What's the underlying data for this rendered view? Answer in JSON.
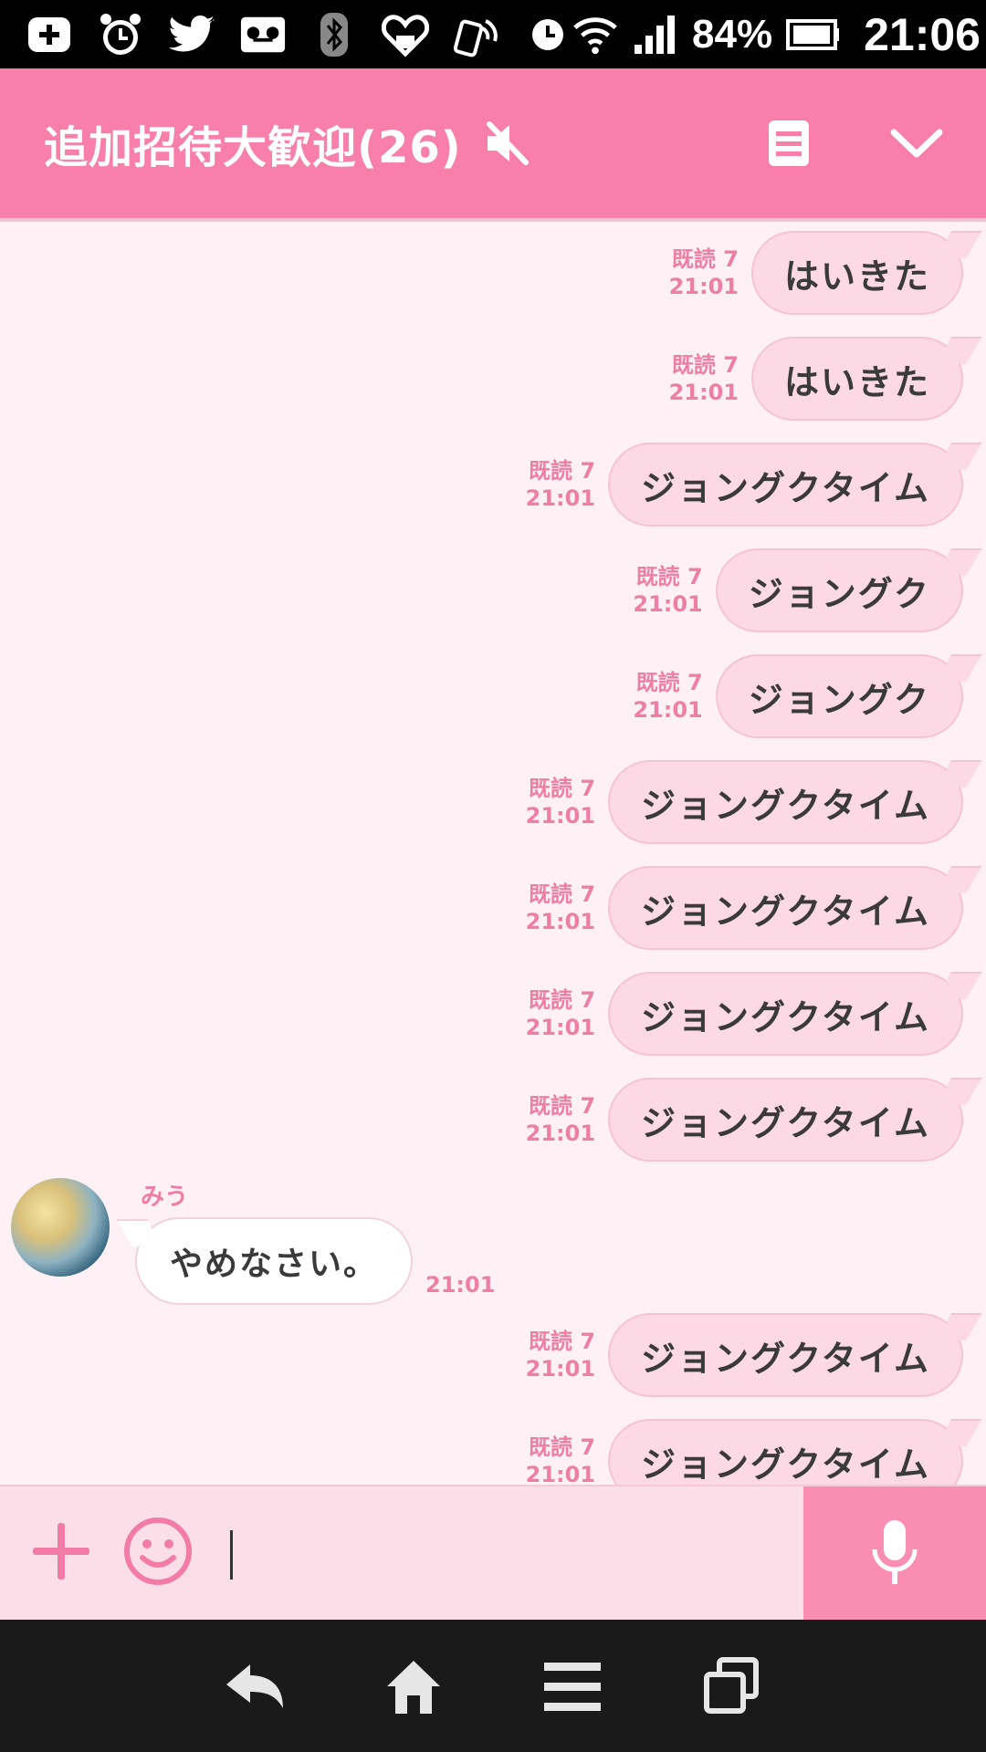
{
  "status_bar": {
    "battery_percent": "84%",
    "time": "21:06",
    "icons": [
      "add-icon",
      "alarm-icon",
      "twitter-icon",
      "voicemail-icon",
      "bluetooth-icon",
      "heart-icon",
      "nfc-icon",
      "clock-icon",
      "wifi-icon",
      "signal-icon",
      "battery-icon"
    ]
  },
  "header": {
    "title": "追加招待大歓迎(26)",
    "icons": [
      "mute-icon",
      "notes-icon",
      "chevron-down-icon"
    ]
  },
  "messages": [
    {
      "direction": "out",
      "text": "はいきた",
      "read": "既読 7",
      "time": "21:01"
    },
    {
      "direction": "out",
      "text": "はいきた",
      "read": "既読 7",
      "time": "21:01"
    },
    {
      "direction": "out",
      "text": "ジョングクタイム",
      "read": "既読 7",
      "time": "21:01"
    },
    {
      "direction": "out",
      "text": "ジョングク",
      "read": "既読 7",
      "time": "21:01"
    },
    {
      "direction": "out",
      "text": "ジョングク",
      "read": "既読 7",
      "time": "21:01"
    },
    {
      "direction": "out",
      "text": "ジョングクタイム",
      "read": "既読 7",
      "time": "21:01"
    },
    {
      "direction": "out",
      "text": "ジョングクタイム",
      "read": "既読 7",
      "time": "21:01"
    },
    {
      "direction": "out",
      "text": "ジョングクタイム",
      "read": "既読 7",
      "time": "21:01"
    },
    {
      "direction": "out",
      "text": "ジョングクタイム",
      "read": "既読 7",
      "time": "21:01"
    },
    {
      "direction": "in",
      "sender": "みう",
      "text": "やめなさい。",
      "time": "21:01"
    },
    {
      "direction": "out",
      "text": "ジョングクタイム",
      "read": "既読 7",
      "time": "21:01"
    },
    {
      "direction": "out",
      "text": "ジョングクタイム",
      "read": "既読 7",
      "time": "21:01"
    }
  ],
  "input": {
    "value": "",
    "icons": [
      "plus-icon",
      "smiley-icon",
      "microphone-icon"
    ]
  },
  "nav_bar": {
    "icons": [
      "back-icon",
      "home-icon",
      "menu-icon",
      "recent-apps-icon"
    ]
  },
  "colors": {
    "header": "#f77fa9",
    "chat_background": "#fdf1f5",
    "outgoing_bubble": "#fcd9e4",
    "meta_text": "#ef7ea4",
    "input_bar": "#fbdfe8",
    "mic_button": "#f98db2",
    "nav_bar": "#1a1a1a"
  }
}
